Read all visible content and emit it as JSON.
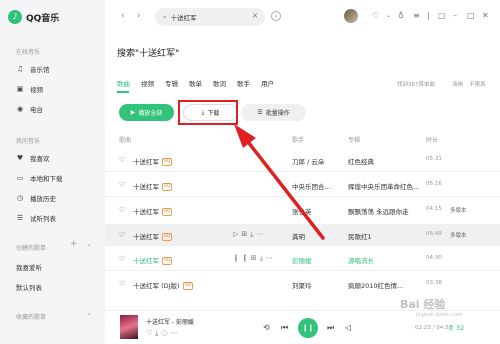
{
  "app": {
    "logo_text": "QQ音乐"
  },
  "sidebar": {
    "section_online": "在线音乐",
    "online_items": [
      {
        "icon": "music-note-icon",
        "label": "音乐馆"
      },
      {
        "icon": "video-icon",
        "label": "视频"
      },
      {
        "icon": "radio-icon",
        "label": "电台"
      }
    ],
    "section_mine": "我的音乐",
    "mine_items": [
      {
        "icon": "heart-icon",
        "label": "我喜欢"
      },
      {
        "icon": "computer-icon",
        "label": "本地和下载"
      },
      {
        "icon": "history-icon",
        "label": "播放历史"
      },
      {
        "icon": "list-icon",
        "label": "试听列表"
      }
    ],
    "section_created": "创建的歌单",
    "created_items": [
      "我喜爱听",
      "默认列表"
    ],
    "section_collected": "收藏的歌单"
  },
  "topbar": {
    "search_value": "十送红军",
    "clear": "✕"
  },
  "search_title": "搜索\"十送红军\"",
  "tabs": [
    "歌曲",
    "视频",
    "专辑",
    "歌单",
    "歌词",
    "歌手",
    "用户"
  ],
  "active_tab": "歌曲",
  "result_meta": "找到367首单曲",
  "meta_links": [
    "清晰",
    "不限表"
  ],
  "actions": {
    "play_all": "播放全部",
    "download": "下载",
    "batch": "批量操作"
  },
  "table": {
    "headers": {
      "song": "歌曲",
      "singer": "歌手",
      "album": "专辑",
      "duration": "时长"
    },
    "rows": [
      {
        "name": "十送红军",
        "badge": "SQ",
        "singer": "刀郎 / 云朵",
        "album": "红色经典",
        "dur": "05:31",
        "more": ""
      },
      {
        "name": "十送红军",
        "badge": "SQ",
        "singer": "中央乐团合...",
        "album": "辉煌中央乐团革命红色...",
        "dur": "05:16",
        "more": ""
      },
      {
        "name": "十送红军",
        "badge": "SQ",
        "singer": "张也英",
        "album": "飘飘荡荡 永远跟你走",
        "dur": "04:15",
        "more": "多版本"
      },
      {
        "name": "十送红军",
        "badge": "SQ",
        "singer": "龚玥",
        "album": "民歌红1",
        "dur": "06:49",
        "more": "多版本"
      },
      {
        "name": "十送红军",
        "badge": "SQ",
        "singer": "彭丽媛",
        "album": "源唱流长",
        "dur": "04:30",
        "more": ""
      },
      {
        "name": "十送红军 (DJ版)",
        "badge": "SQ",
        "singer": "刘聚玲",
        "album": "疯颠2010红色情...",
        "dur": "03:38",
        "more": ""
      }
    ]
  },
  "player": {
    "title": "十送红军 - 彭丽媛",
    "time": "02:23 / 04:30",
    "extra": "♫ 32"
  },
  "watermark": {
    "main": "Bai 经验",
    "sub": "jingyan.baidu.com"
  }
}
